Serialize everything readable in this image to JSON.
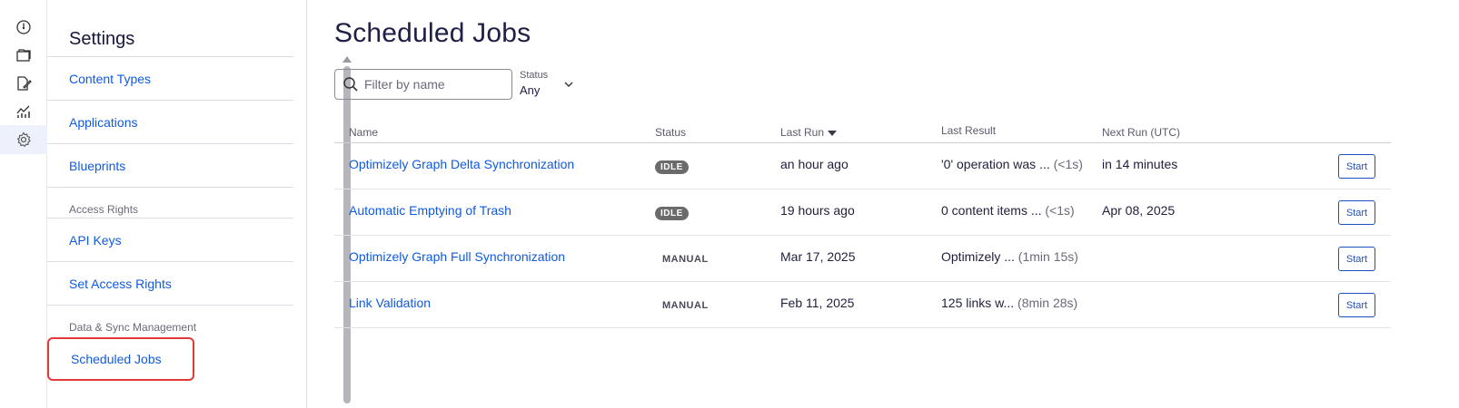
{
  "rail": {
    "items": [
      {
        "icon": "dashboard-icon"
      },
      {
        "icon": "folders-icon"
      },
      {
        "icon": "edit-document-icon"
      },
      {
        "icon": "analytics-icon"
      },
      {
        "icon": "gear-icon",
        "active": true
      }
    ]
  },
  "sidebar": {
    "title": "Settings",
    "items": [
      {
        "type": "link",
        "label": "Content Types"
      },
      {
        "type": "link",
        "label": "Applications"
      },
      {
        "type": "link",
        "label": "Blueprints"
      },
      {
        "type": "group",
        "label": "Access Rights"
      },
      {
        "type": "link",
        "label": "API Keys"
      },
      {
        "type": "link",
        "label": "Set Access Rights"
      },
      {
        "type": "group",
        "label": "Data & Sync Management"
      },
      {
        "type": "link",
        "label": "Scheduled Jobs",
        "selected": true
      }
    ]
  },
  "main": {
    "title": "Scheduled Jobs",
    "filter": {
      "placeholder": "Filter by name",
      "value": ""
    },
    "status_filter": {
      "label": "Status",
      "value": "Any"
    },
    "table": {
      "headers": {
        "name": "Name",
        "status": "Status",
        "last_run": "Last Run",
        "last_result": "Last Result",
        "next_run": "Next Run (UTC)"
      },
      "sort": {
        "column": "last_run",
        "direction": "descending"
      },
      "rows": [
        {
          "name": "Optimizely Graph Delta Synchronization",
          "status": "IDLE",
          "status_style": "idle",
          "last_run": "an hour ago",
          "last_result": "'0' operation was ...",
          "duration": "(<1s)",
          "next_run": "in 14 minutes",
          "action": "Start"
        },
        {
          "name": "Automatic Emptying of Trash",
          "status": "IDLE",
          "status_style": "idle",
          "last_run": "19 hours ago",
          "last_result": "0 content items ...",
          "duration": "(<1s)",
          "next_run": "Apr 08, 2025",
          "action": "Start"
        },
        {
          "name": "Optimizely Graph Full Synchronization",
          "status": "MANUAL",
          "status_style": "manual",
          "last_run": "Mar 17, 2025",
          "last_result": "Optimizely ...",
          "duration": "(1min 15s)",
          "next_run": "",
          "action": "Start"
        },
        {
          "name": "Link Validation",
          "status": "MANUAL",
          "status_style": "manual",
          "last_run": "Feb 11, 2025",
          "last_result": "125 links w...",
          "duration": "(8min 28s)",
          "next_run": "",
          "action": "Start"
        }
      ]
    }
  },
  "colors": {
    "link": "#0f5ae0",
    "idle_badge": "#6b6b6b",
    "start_button": "#1f4fc4",
    "selection_highlight": "#e03a3a",
    "rail_active": "#eef0fb"
  }
}
